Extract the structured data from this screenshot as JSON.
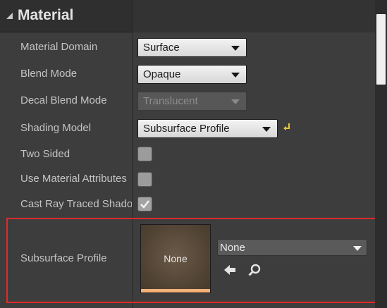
{
  "category": {
    "title": "Material",
    "expanded": true
  },
  "properties": {
    "material_domain": {
      "label": "Material Domain",
      "value": "Surface"
    },
    "blend_mode": {
      "label": "Blend Mode",
      "value": "Opaque"
    },
    "decal_blend_mode": {
      "label": "Decal Blend Mode",
      "value": "Translucent",
      "enabled": false
    },
    "shading_model": {
      "label": "Shading Model",
      "value": "Subsurface Profile",
      "reset_icon": "reset-to-default-icon"
    },
    "two_sided": {
      "label": "Two Sided",
      "checked": false
    },
    "use_material_attributes": {
      "label": "Use Material Attributes",
      "checked": false
    },
    "cast_ray_traced_shadows": {
      "label": "Cast Ray Traced Shadows",
      "checked": true
    },
    "subsurface_profile": {
      "label": "Subsurface Profile",
      "thumbnail_label": "None",
      "asset_value": "None",
      "buttons": [
        "use-selected-arrow-icon",
        "browse-search-icon"
      ],
      "highlighted": true,
      "highlight_color": "#e02a2a"
    }
  },
  "colors": {
    "panel_bg": "#3d3d3d",
    "header_bg": "#2f2f2f",
    "thumbnail_bar": "#f3b17a"
  }
}
